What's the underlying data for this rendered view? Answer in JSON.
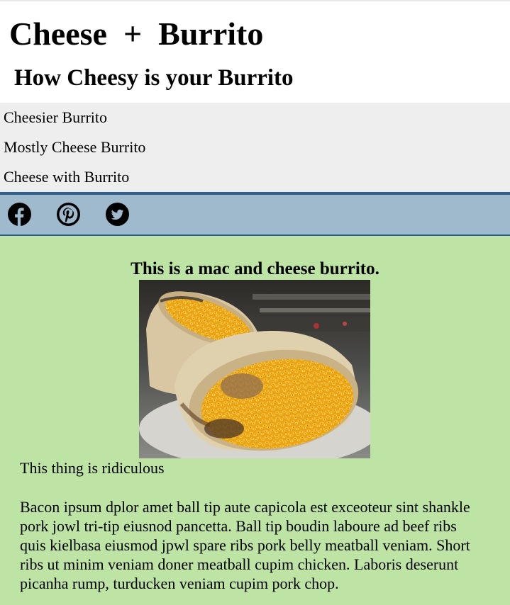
{
  "header": {
    "title": "Cheese  +  Burrito",
    "subtitle": "How Cheesy is your Burrito"
  },
  "nav": {
    "items": [
      {
        "label": "Cheesier Burrito"
      },
      {
        "label": "Mostly Cheese Burrito"
      },
      {
        "label": "Cheese with Burrito"
      }
    ]
  },
  "social": {
    "icons": [
      "facebook-icon",
      "pinterest-icon",
      "twitter-icon"
    ]
  },
  "content": {
    "caption": "This is a mac and cheese burrito.",
    "tagline": "This thing is ridiculous",
    "body_lines": [
      "Bacon ipsum dplor amet ball tip aute capicola est exceoteur sint shankle",
      "pork jowl tri-tip eiusnod pancetta. Ball tip boudin laboure ad beef ribs",
      "quis kielbasa eiusmod jpwl spare ribs pork belly meatball veniam. Short",
      "ribs ut minim veniam doner meatball cupim chicken. Laboris deserunt",
      "picanha rump, turducken veniam cupim pork chop."
    ]
  },
  "colors": {
    "nav_bg": "#eeeeee",
    "social_bg": "#9fb9cd",
    "social_border": "#2e5f8d",
    "content_bg": "#bde4a5"
  }
}
